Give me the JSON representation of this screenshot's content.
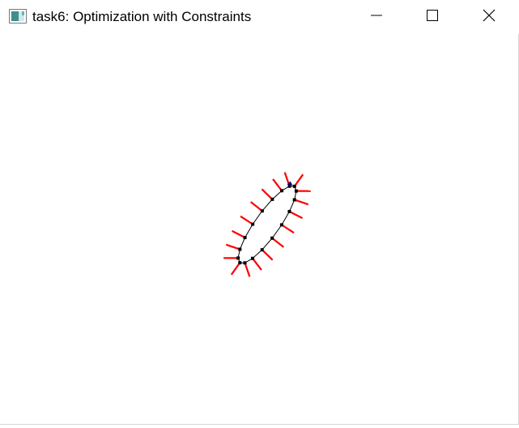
{
  "window": {
    "title": "task6: Optimization with Constraints",
    "controls": {
      "minimize": "minimize-icon",
      "maximize": "maximize-icon",
      "close": "close-icon"
    }
  },
  "colors": {
    "background": "#ffffff",
    "curve": "#000000",
    "vectors": "#ff0000",
    "handle": "#00008b"
  }
}
